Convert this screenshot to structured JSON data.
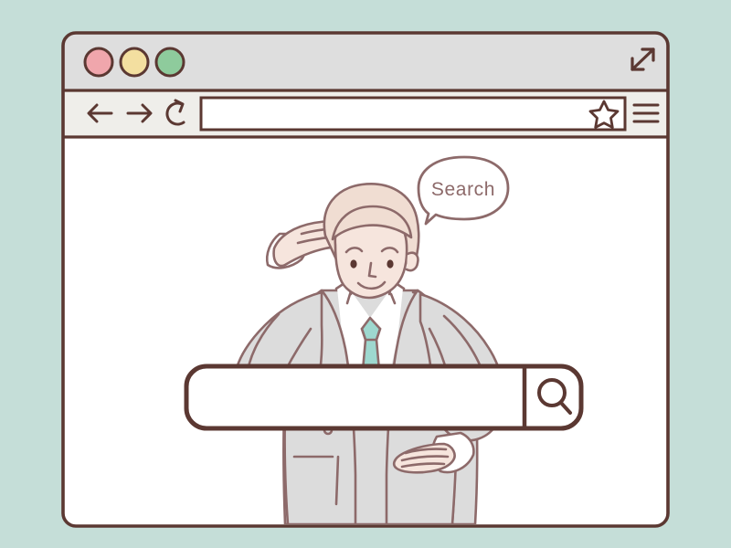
{
  "scene": {
    "background_color": "#c5ded8",
    "outline_color": "#5b3832",
    "description": "Flat line illustration of a browser window with a businessman looking into the distance above a large search bar"
  },
  "browser_window": {
    "titlebar": {
      "background_color": "#dedede",
      "traffic_lights": [
        {
          "name": "close",
          "color": "#f0a6ac"
        },
        {
          "name": "minimize",
          "color": "#f3dfa0"
        },
        {
          "name": "maximize",
          "color": "#8ecb9c"
        }
      ],
      "expand_icon": "expand-arrows-icon"
    },
    "toolbar": {
      "background_color": "#efeeea",
      "back_icon": "back-arrow-icon",
      "forward_icon": "forward-arrow-icon",
      "reload_icon": "reload-icon",
      "address_bar": {
        "value": "",
        "placeholder": "",
        "bookmark_icon": "star-icon"
      },
      "menu_icon": "hamburger-menu-icon"
    },
    "content": {
      "background_color": "#ffffff"
    }
  },
  "illustration": {
    "speech_bubble": {
      "text": "Search",
      "text_color": "#8d6a6a"
    },
    "character": {
      "name": "businessman-looking-out",
      "suit_color": "#dcdcdc",
      "shirt_color": "#ffffff",
      "tie_color": "#9ed8cf",
      "skin_color": "#f6e5dd",
      "hair_color": "#f0ddd2"
    }
  },
  "search_bar": {
    "value": "",
    "placeholder": "",
    "search_icon": "magnifier-icon",
    "fill_color": "#ffffff",
    "border_color": "#5b3832"
  }
}
